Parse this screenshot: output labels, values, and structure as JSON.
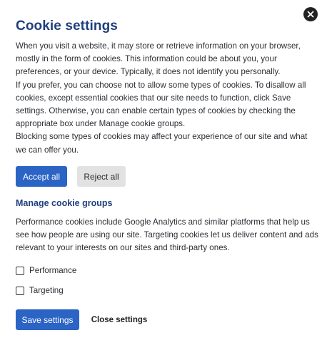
{
  "dialog": {
    "title": "Cookie settings",
    "paragraphs": [
      "When you visit a website, it may store or retrieve information on your browser, mostly in the form of cookies. This information could be about you, your preferences, or your device. Typically, it does not identify you personally.",
      "If you prefer, you can choose not to allow some types of cookies. To disallow all cookies, except essential cookies that our site needs to function, click Save settings. Otherwise, you can enable certain types of cookies by checking the appropriate box under Manage cookie groups.",
      "Blocking some types of cookies may affect your experience of our site and what we can offer you."
    ],
    "accept_all_label": "Accept all",
    "reject_all_label": "Reject all",
    "manage_title": "Manage cookie groups",
    "manage_text": "Performance cookies include Google Analytics and similar platforms that help us see how people are using our site. Targeting cookies let us deliver content and ads relevant to your interests on our sites and third-party ones.",
    "groups": [
      {
        "label": "Performance",
        "checked": false
      },
      {
        "label": "Targeting",
        "checked": false
      }
    ],
    "save_label": "Save settings",
    "close_label": "Close settings",
    "close_icon": "close-icon"
  },
  "colors": {
    "title": "#1f3f7c",
    "primary_button": "#2b64c5",
    "secondary_button": "#e2e2e2",
    "close_icon_bg": "#222222"
  }
}
